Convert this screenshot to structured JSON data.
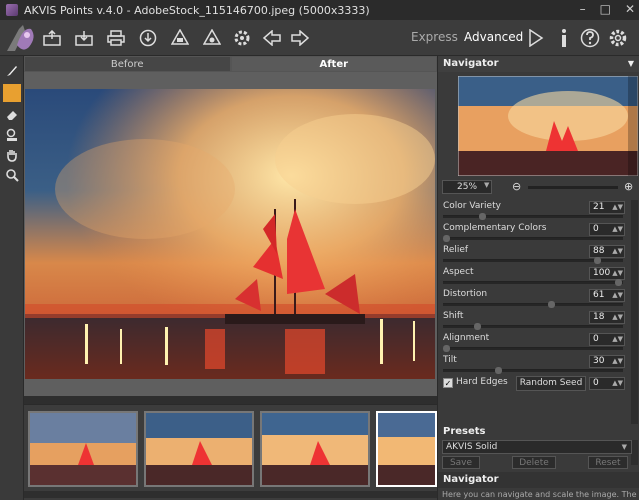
{
  "window": {
    "title": "AKVIS Points v.4.0 - AdobeStock_115146700.jpeg (5000x3333)",
    "minimize": "–",
    "maximize": "□",
    "close": "✕"
  },
  "toolbar": {
    "icons": [
      "open-icon",
      "save-icon",
      "print-icon",
      "share-icon",
      "batch-icon",
      "plugin-icon",
      "settings-gear-icon",
      "undo-icon",
      "redo-icon"
    ],
    "express_label": "Express",
    "advanced_label": "Advanced",
    "run_icon": "play-icon",
    "info_icon": "info-icon",
    "help_icon": "help-icon",
    "prefs_icon": "gear-icon"
  },
  "tools": [
    "brush-icon",
    "color-swatch",
    "eraser-icon",
    "stamp-icon",
    "hand-icon",
    "zoom-icon"
  ],
  "tabs": {
    "before": "Before",
    "after": "After"
  },
  "navigator": {
    "title": "Navigator",
    "zoom": "25%"
  },
  "params": [
    {
      "label": "Color Variety",
      "value": "21",
      "level": 0.21
    },
    {
      "label": "Complementary Colors",
      "value": "0",
      "level": 0.0
    },
    {
      "label": "Relief",
      "value": "88",
      "level": 0.88
    },
    {
      "label": "Aspect",
      "value": "100",
      "level": 1.0
    },
    {
      "label": "Distortion",
      "value": "61",
      "level": 0.61
    },
    {
      "label": "Shift",
      "value": "18",
      "level": 0.18
    },
    {
      "label": "Alignment",
      "value": "0",
      "level": 0.0
    },
    {
      "label": "Tilt",
      "value": "30",
      "level": 0.3
    }
  ],
  "hard_edges": {
    "label": "Hard Edges",
    "checked": true
  },
  "random_seed": {
    "label": "Random Seed",
    "value": "0"
  },
  "presets": {
    "title": "Presets",
    "selected": "AKVIS Solid",
    "save": "Save",
    "delete": "Delete",
    "reset": "Reset"
  },
  "bottom_navigator": {
    "title": "Navigator",
    "help_text": "Here you can navigate and scale the image. The"
  }
}
